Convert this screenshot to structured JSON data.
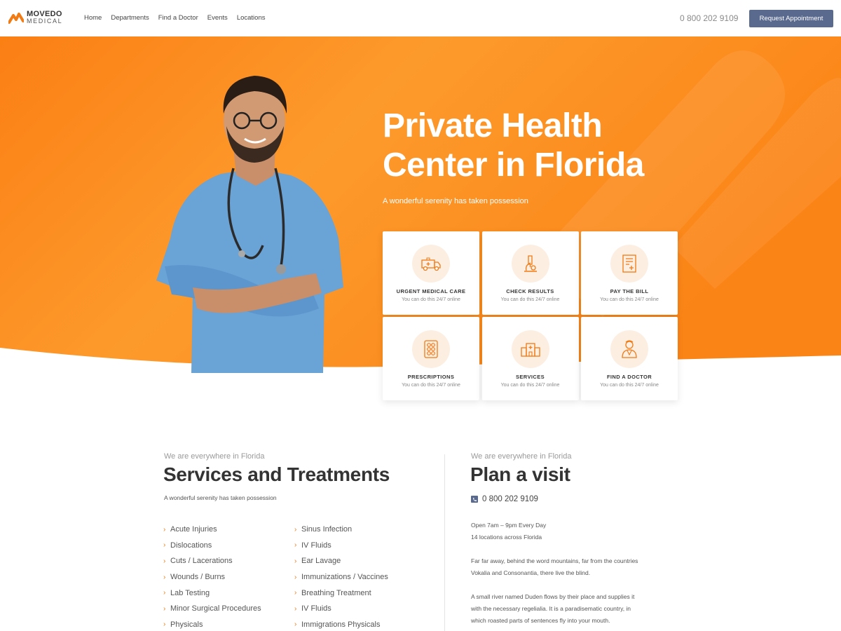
{
  "header": {
    "logo_top": "MOVEDO",
    "logo_bottom": "MEDICAL",
    "nav": [
      "Home",
      "Departments",
      "Find a Doctor",
      "Events",
      "Locations"
    ],
    "phone": "0 800 202 9109",
    "appointment_button": "Request Appointment"
  },
  "hero": {
    "title": "Private Health Center in Florida",
    "subtitle": "A wonderful serenity has taken possession"
  },
  "cards": [
    {
      "title": "URGENT MEDICAL CARE",
      "sub": "You can do this 24/7 online",
      "icon": "ambulance-icon"
    },
    {
      "title": "CHECK RESULTS",
      "sub": "You can do this 24/7 online",
      "icon": "microscope-icon"
    },
    {
      "title": "PAY THE BILL",
      "sub": "You can do this 24/7 online",
      "icon": "bill-icon"
    },
    {
      "title": "PRESCRIPTIONS",
      "sub": "You can do this 24/7 online",
      "icon": "pills-icon"
    },
    {
      "title": "SERVICES",
      "sub": "You can do this 24/7 online",
      "icon": "hospital-icon"
    },
    {
      "title": "FIND A DOCTOR",
      "sub": "You can do this 24/7 online",
      "icon": "doctor-icon"
    }
  ],
  "services": {
    "eyebrow": "We are everywhere in Florida",
    "title": "Services and Treatments",
    "subtitle": "A wonderful serenity has taken possession",
    "col1": [
      "Acute Injuries",
      "Dislocations",
      "Cuts / Lacerations",
      "Wounds / Burns",
      "Lab Testing",
      "Minor Surgical Procedures",
      "Physicals"
    ],
    "col2": [
      "Sinus Infection",
      "IV Fluids",
      "Ear Lavage",
      "Immunizations / Vaccines",
      "Breathing Treatment",
      "IV Fluids",
      "Immigrations Physicals"
    ]
  },
  "visit": {
    "eyebrow": "We are everywhere in Florida",
    "title": "Plan a visit",
    "phone": "0 800 202 9109",
    "hours": "Open 7am – 9pm Every Day",
    "locations": "14 locations across Florida",
    "para1": "Far far away, behind the word mountains, far from the countries Vokalia and Consonantia, there live the blind.",
    "para2": "A small river named Duden flows by their place and supplies it with the necessary regelialia. It is a paradisematic country, in which roasted parts of sentences fly into your mouth."
  },
  "colors": {
    "accent": "#f07a14",
    "hero_orange": "#fb8a1c",
    "button": "#5a6a8e"
  }
}
